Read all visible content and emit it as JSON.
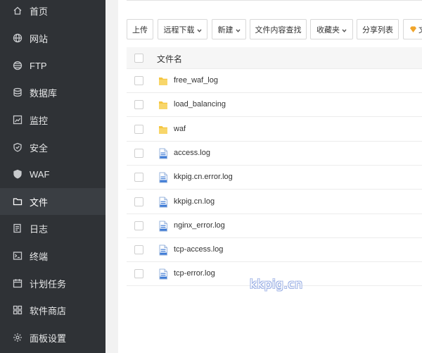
{
  "sidebar": {
    "items": [
      {
        "label": "首页",
        "icon": "home-icon"
      },
      {
        "label": "网站",
        "icon": "globe-icon"
      },
      {
        "label": "FTP",
        "icon": "ftp-icon"
      },
      {
        "label": "数据库",
        "icon": "database-icon"
      },
      {
        "label": "监控",
        "icon": "monitor-icon"
      },
      {
        "label": "安全",
        "icon": "shield-icon"
      },
      {
        "label": "WAF",
        "icon": "waf-shield-icon"
      },
      {
        "label": "文件",
        "icon": "folder-icon",
        "active": true
      },
      {
        "label": "日志",
        "icon": "log-icon"
      },
      {
        "label": "终端",
        "icon": "terminal-icon"
      },
      {
        "label": "计划任务",
        "icon": "calendar-icon"
      },
      {
        "label": "软件商店",
        "icon": "apps-icon"
      },
      {
        "label": "面板设置",
        "icon": "settings-icon"
      }
    ]
  },
  "toolbar": {
    "upload": "上传",
    "remote_download": "远程下载",
    "new": "新建",
    "content_search": "文件内容查找",
    "favorites": "收藏夹",
    "share_list": "分享列表",
    "extra": "文"
  },
  "table": {
    "header": "文件名",
    "rows": [
      {
        "name": "free_waf_log",
        "type": "folder"
      },
      {
        "name": "load_balancing",
        "type": "folder"
      },
      {
        "name": "waf",
        "type": "folder"
      },
      {
        "name": "access.log",
        "type": "file"
      },
      {
        "name": "kkpig.cn.error.log",
        "type": "file"
      },
      {
        "name": "kkpig.cn.log",
        "type": "file"
      },
      {
        "name": "nginx_error.log",
        "type": "file"
      },
      {
        "name": "tcp-access.log",
        "type": "file"
      },
      {
        "name": "tcp-error.log",
        "type": "file"
      }
    ]
  },
  "watermark": "kkpig.cn",
  "colors": {
    "sidebar_bg": "#2f3236",
    "sidebar_active_bg": "#3a3e43",
    "folder": "#f5c642",
    "file_accent": "#3e7bd6"
  }
}
